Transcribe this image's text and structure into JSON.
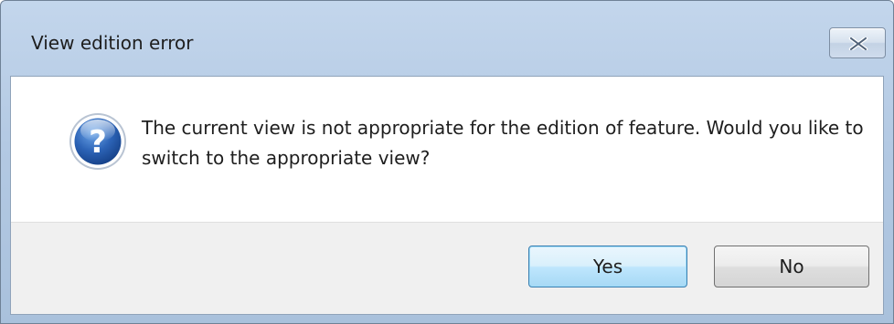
{
  "dialog": {
    "title": "View edition error",
    "message": "The current view is not appropriate for the edition of feature. Would you like to switch to the appropriate view?",
    "icon": "question-icon",
    "close_icon": "close-icon",
    "buttons": {
      "yes_label": "Yes",
      "no_label": "No"
    }
  },
  "colors": {
    "titlebar": "#b9cee7",
    "icon_blue": "#1f57a8",
    "default_button_border": "#3c7fb1"
  }
}
